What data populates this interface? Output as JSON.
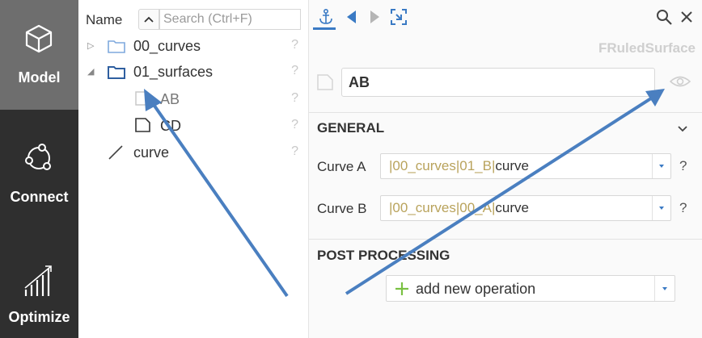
{
  "nav": {
    "items": [
      {
        "label": "Model",
        "icon": "cube-icon",
        "active": true
      },
      {
        "label": "Connect",
        "icon": "network-icon",
        "active": false
      },
      {
        "label": "Optimize",
        "icon": "bar-chart-icon",
        "active": false
      }
    ]
  },
  "tree": {
    "name_label": "Name",
    "search_placeholder": "Search (Ctrl+F)",
    "rows": [
      {
        "label": "00_curves",
        "icon": "folder-icon",
        "expanded": false,
        "help": "?"
      },
      {
        "label": "01_surfaces",
        "icon": "folder-icon",
        "expanded": true,
        "help": "?"
      },
      {
        "label": "AB",
        "icon": "surface-icon",
        "help": "?"
      },
      {
        "label": "CD",
        "icon": "surface-icon",
        "help": "?"
      },
      {
        "label": "curve",
        "icon": "line-icon",
        "help": "?"
      }
    ]
  },
  "props": {
    "type_label": "FRuledSurface",
    "name_value": "AB",
    "general": {
      "title": "GENERAL",
      "curve_a": {
        "label": "Curve A",
        "path": "|00_curves|01_B|",
        "name": "curve",
        "help": "?"
      },
      "curve_b": {
        "label": "Curve B",
        "path": "|00_curves|00_A|",
        "name": "curve",
        "help": "?"
      }
    },
    "post_processing": {
      "title": "POST PROCESSING",
      "add_label": "add new operation"
    }
  },
  "colors": {
    "accent": "#3a7ac4",
    "nav_bg": "#2f2f2f",
    "nav_active": "#6e6e6e",
    "arrow": "#4a7fc0",
    "plus": "#7ac143"
  }
}
